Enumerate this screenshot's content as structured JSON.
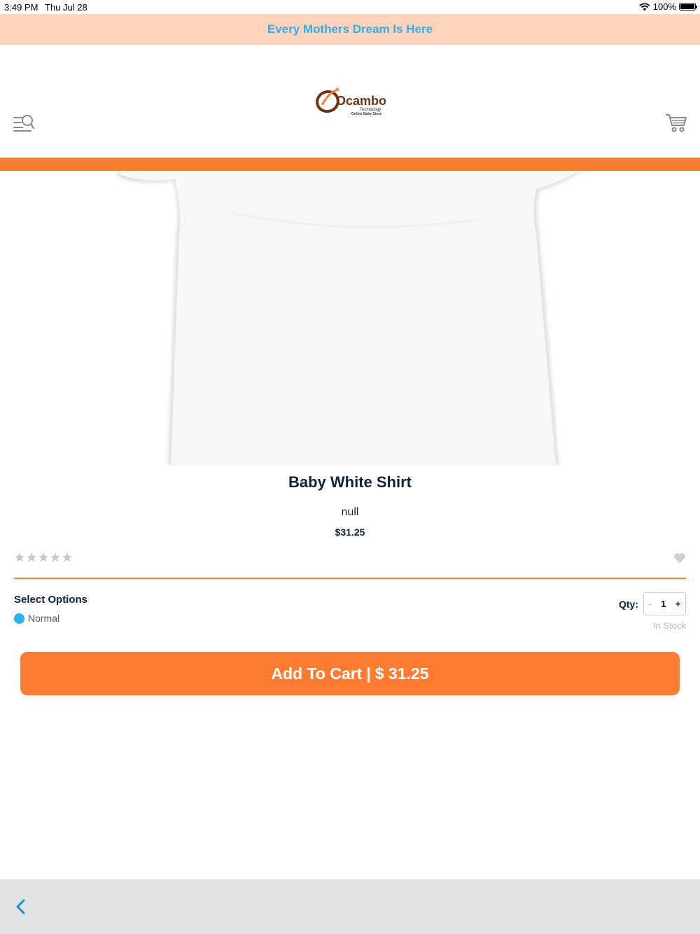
{
  "status_bar": {
    "time": "3:49 PM",
    "date": "Thu Jul 28",
    "battery": "100%"
  },
  "promo_banner": {
    "text": "Every Mothers Dream Is Here",
    "color": "#2ab0e8",
    "background": "#ffd2bb"
  },
  "header": {
    "logo": {
      "brand": "Ocambo",
      "sub1": "Technology",
      "sub2": "Online Baby Store"
    },
    "menu_icon": "menu-search-icon",
    "cart_icon": "shopping-cart-icon"
  },
  "accent_color": "#fe7c31",
  "product": {
    "title": "Baby White Shirt",
    "description": "null",
    "price": "$31.25",
    "rating": 0,
    "rating_max": 5
  },
  "options": {
    "label": "Select Options",
    "selected": "Normal",
    "selected_color": "#29b3ee"
  },
  "quantity": {
    "label": "Qty:",
    "minus": "-",
    "value": "1",
    "plus": "+",
    "stock": "In Stock"
  },
  "add_to_cart": {
    "label": "Add To Cart",
    "separator": "|",
    "amount": "$ 31.25"
  },
  "bottom_bar": {
    "back_icon": "chevron-left-icon"
  }
}
